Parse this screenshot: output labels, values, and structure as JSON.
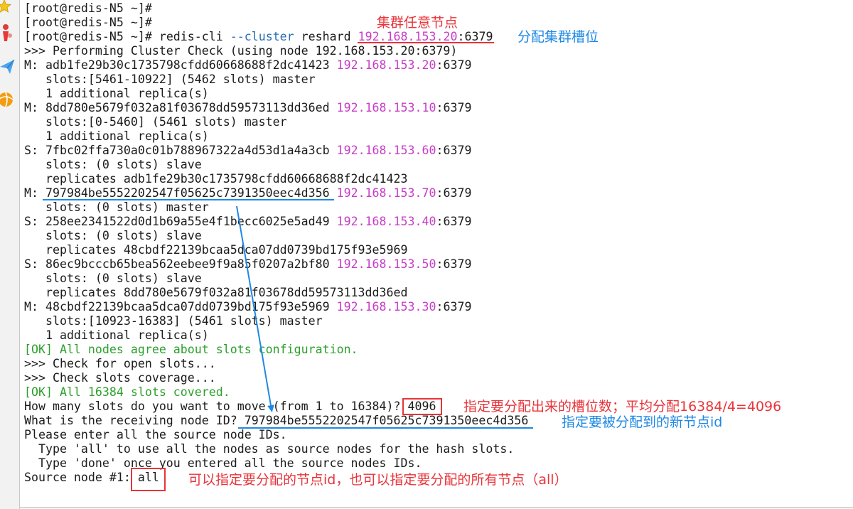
{
  "sidebar": {
    "icons": [
      "star-icon",
      "pin-icon",
      "paper-plane-icon",
      "ball-icon"
    ]
  },
  "terminal": {
    "prompt_lines": [
      "[root@redis-N5 ~]#",
      "[root@redis-N5 ~]#"
    ],
    "command": {
      "prompt": "[root@redis-N5 ~]#",
      "program": "redis-cli",
      "flag": "--cluster",
      "subcommand": "reshard",
      "ip": "192.168.153.20",
      "port": ":6379"
    },
    "check_header": ">>> Performing Cluster Check (using node 192.168.153.20:6379)",
    "nodes": [
      {
        "role": "M:",
        "id": "adb1fe29b30c1735798cfdd60668688f2dc41423",
        "ip": "192.168.153.20",
        "port": ":6379",
        "details": [
          "slots:[5461-10922] (5462 slots) master",
          "1 additional replica(s)"
        ]
      },
      {
        "role": "M:",
        "id": "8dd780e5679f032a81f03678dd59573113dd36ed",
        "ip": "192.168.153.10",
        "port": ":6379",
        "details": [
          "slots:[0-5460] (5461 slots) master",
          "1 additional replica(s)"
        ]
      },
      {
        "role": "S:",
        "id": "7fbc02ffa730a0c01b788967322a4d53d1a4a3cb",
        "ip": "192.168.153.60",
        "port": ":6379",
        "details": [
          "slots: (0 slots) slave",
          "replicates adb1fe29b30c1735798cfdd60668688f2dc41423"
        ]
      },
      {
        "role": "M:",
        "id": "797984be5552202547f05625c7391350eec4d356",
        "ip": "192.168.153.70",
        "port": ":6379",
        "details": [
          "slots: (0 slots) master"
        ]
      },
      {
        "role": "S:",
        "id": "258ee2341522d0d1b69a55e4f1becc6025e5ad49",
        "ip": "192.168.153.40",
        "port": ":6379",
        "details": [
          "slots: (0 slots) slave",
          "replicates 48cbdf22139bcaa5dca07dd0739bd175f93e5969"
        ]
      },
      {
        "role": "S:",
        "id": "86ec9bcccb65bea562eebee9f9a85f0207a2bf80",
        "ip": "192.168.153.50",
        "port": ":6379",
        "details": [
          "slots: (0 slots) slave",
          "replicates 8dd780e5679f032a81f03678dd59573113dd36ed"
        ]
      },
      {
        "role": "M:",
        "id": "48cbdf22139bcaa5dca07dd0739bd175f93e5969",
        "ip": "192.168.153.30",
        "port": ":6379",
        "details": [
          "slots:[10923-16383] (5461 slots) master",
          "1 additional replica(s)"
        ]
      }
    ],
    "ok_agree": "[OK] All nodes agree about slots configuration.",
    "check_open": ">>> Check for open slots...",
    "check_coverage": ">>> Check slots coverage...",
    "ok_covered": "[OK] All 16384 slots covered.",
    "slots_question": "How many slots do you want to move (from 1 to 16384)?",
    "slots_answer": "4096",
    "receiving_question": "What is the receiving node ID?",
    "receiving_answer": "797984be5552202547f05625c7391350eec4d356",
    "source_instructions": [
      "Please enter all the source node IDs.",
      "Type 'all' to use all the nodes as source nodes for the hash slots.",
      "Type 'done' once you entered all the source nodes IDs."
    ],
    "source_question": "Source node #1:",
    "source_answer": "all"
  },
  "annotations": {
    "any_node": "集群任意节点",
    "assign_slots": "分配集群槽位",
    "slot_count": "指定要分配出来的槽位数；平均分配16384/4=4096",
    "new_node_id": "指定要被分配到的新节点id",
    "source_nodes": "可以指定要分配的节点id，也可以指定要分配的所有节点（all）"
  },
  "colors": {
    "ip": "#c83cc8",
    "flag": "#2a6db5",
    "ok": "#2ca02c",
    "annotation_red": "#e8343a",
    "annotation_blue": "#1e88e5"
  }
}
